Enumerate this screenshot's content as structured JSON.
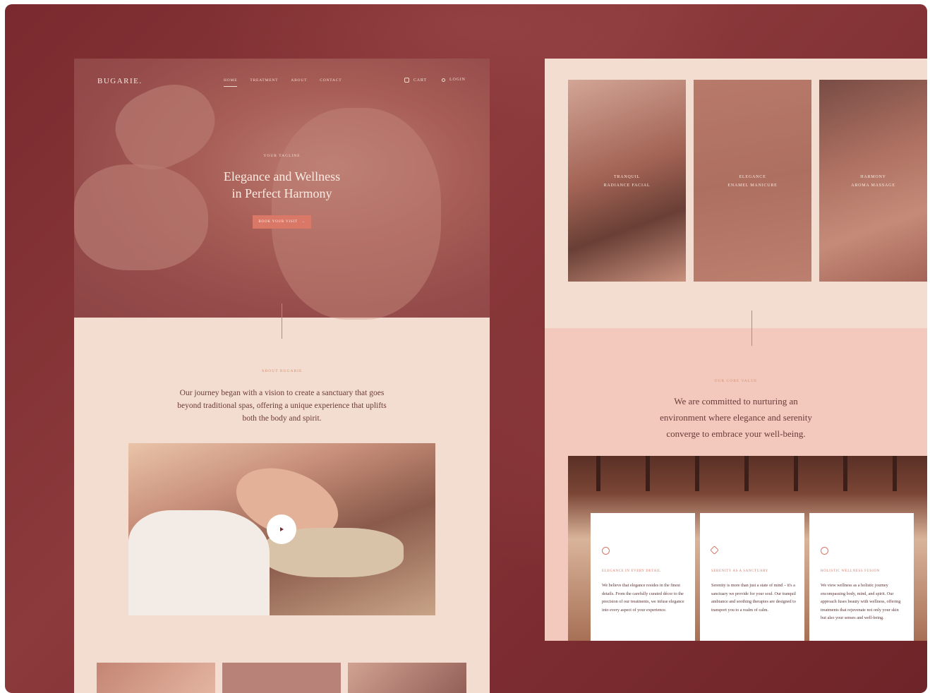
{
  "left": {
    "logo": "BUGARIE.",
    "menu": [
      "HOME",
      "TREATMENT",
      "ABOUT",
      "CONTACT"
    ],
    "active_menu": "HOME",
    "cart_label": "CART",
    "login_label": "LOGIN",
    "tagline": "YOUR TAGLINE",
    "hero_title_line1": "Elegance and Wellness",
    "hero_title_line2": "in Perfect Harmony",
    "book_button": "BOOK YOUR VISIT",
    "about_label": "ABOUT BUGARIE",
    "about_text": "Our journey began with a vision to create a sanctuary that goes beyond traditional spas, offering a unique experience that uplifts both the body and spirit."
  },
  "right": {
    "cards": [
      {
        "line1": "TRANQUIL",
        "line2": "RADIANCE FACIAL"
      },
      {
        "line1": "ELEGANCE",
        "line2": "ENAMEL MANICURE"
      },
      {
        "line1": "HARMONY",
        "line2": "AROMA MASSAGE"
      }
    ],
    "value_label": "OUR CORE VALUE",
    "value_text": "We are committed to nurturing an environment where elegance and serenity converge to embrace your well-being.",
    "values": [
      {
        "icon": "lotus-icon",
        "title": "ELEGANCE IN EVERY DETAIL",
        "body": "We believe that elegance resides in the finest details. From the carefully curated décor to the precision of our treatments, we infuse elegance into every aspect of your experience."
      },
      {
        "icon": "diamond-icon",
        "title": "SERENITY AS A SANCTUARY",
        "body": "Serenity is more than just a state of mind – it's a sanctuary we provide for your soul. Our tranquil ambiance and soothing therapies are designed to transport you to a realm of calm."
      },
      {
        "icon": "face-icon",
        "title": "HOLISTIC WELLNESS FUSION",
        "body": "We view wellness as a holistic journey encompassing body, mind, and spirit. Our approach fuses beauty with wellness, offering treatments that rejuvenate not only your skin but also your senses and well-being."
      }
    ]
  }
}
